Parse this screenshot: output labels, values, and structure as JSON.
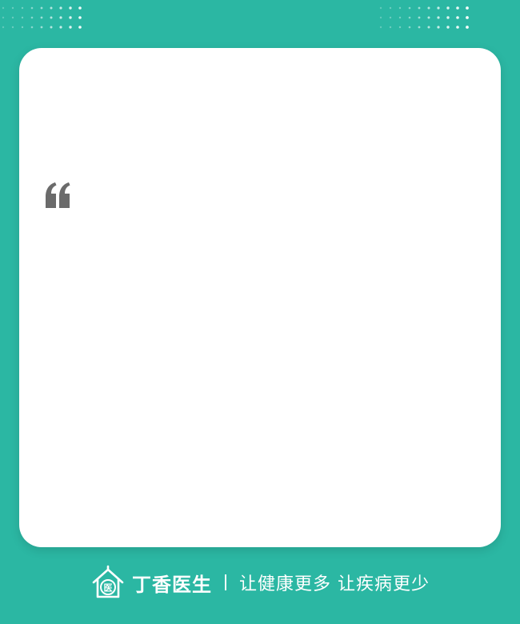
{
  "colors": {
    "background": "#2bb7a3",
    "card": "#ffffff",
    "quote_mark": "#6b6b6b",
    "footer_text": "#ffffff"
  },
  "card": {
    "quote_icon": "open-quote-icon"
  },
  "footer": {
    "logo_icon": "house-hospital-logo-icon",
    "logo_badge_text": "医",
    "brand_name": "丁香医生",
    "slogan": "让健康更多 让疾病更少"
  }
}
